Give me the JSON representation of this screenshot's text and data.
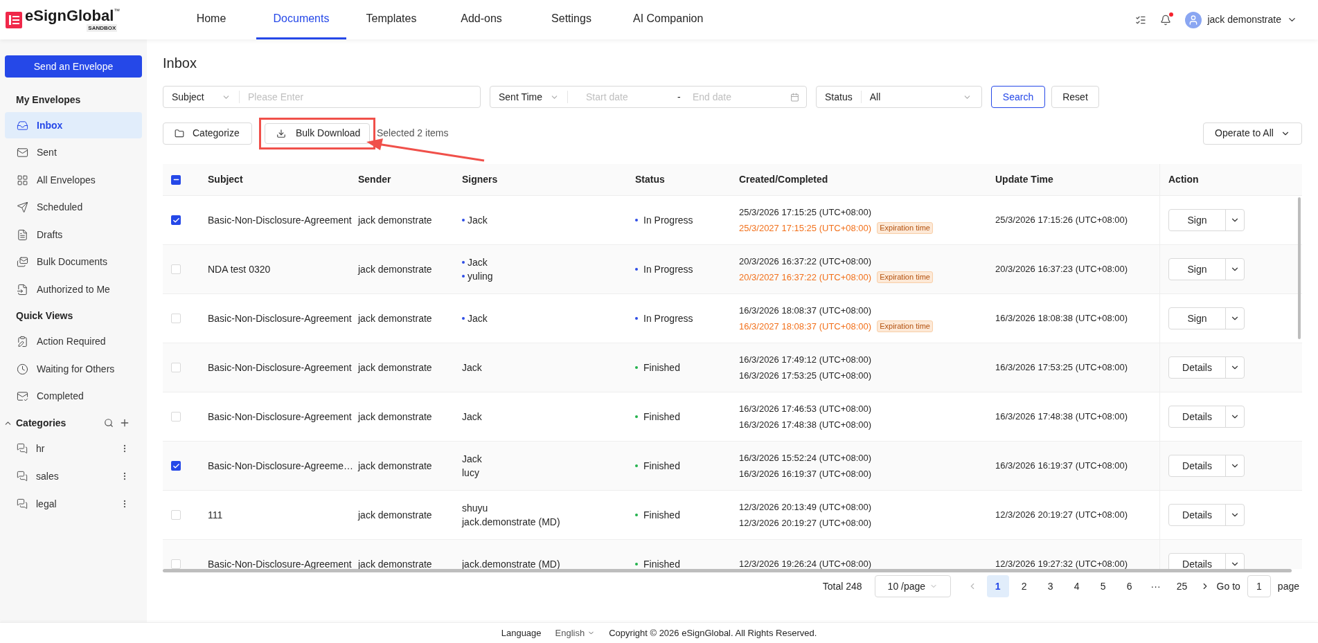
{
  "header": {
    "logo": {
      "name": "eSignGlobal",
      "tm": "™",
      "badge": "SANDBOX"
    },
    "nav": [
      {
        "label": "Home",
        "selected": false
      },
      {
        "label": "Documents",
        "selected": true
      },
      {
        "label": "Templates",
        "selected": false
      },
      {
        "label": "Add-ons",
        "selected": false
      },
      {
        "label": "Settings",
        "selected": false
      },
      {
        "label": "AI Companion",
        "selected": false
      }
    ],
    "notifications": {
      "unread": true
    },
    "user": {
      "name": "jack demonstrate"
    }
  },
  "sidebar": {
    "primary_button": "Send an Envelope",
    "sections": [
      {
        "title": "My Envelopes",
        "items": [
          {
            "label": "Inbox",
            "selected": true
          },
          {
            "label": "Sent",
            "selected": false
          },
          {
            "label": "All Envelopes",
            "selected": false
          },
          {
            "label": "Scheduled",
            "selected": false
          },
          {
            "label": "Drafts",
            "selected": false
          },
          {
            "label": "Bulk Documents",
            "selected": false
          },
          {
            "label": "Authorized to Me",
            "selected": false
          }
        ]
      },
      {
        "title": "Quick Views",
        "items": [
          {
            "label": "Action Required",
            "selected": false
          },
          {
            "label": "Waiting for Others",
            "selected": false
          },
          {
            "label": "Completed",
            "selected": false
          }
        ]
      }
    ],
    "categories": {
      "title": "Categories",
      "expanded": true,
      "items": [
        {
          "label": "hr"
        },
        {
          "label": "sales"
        },
        {
          "label": "legal"
        }
      ]
    }
  },
  "page": {
    "title": "Inbox"
  },
  "filters": {
    "subject": {
      "field": "Subject",
      "placeholder": "Please Enter"
    },
    "time": {
      "field": "Sent Time",
      "start_placeholder": "Start date",
      "separator": "-",
      "end_placeholder": "End date"
    },
    "status": {
      "field": "Status",
      "value": "All"
    },
    "search_button": "Search",
    "reset_button": "Reset"
  },
  "toolbar": {
    "categorize": "Categorize",
    "bulk_download": "Bulk Download",
    "selection": "Selected 2 items",
    "operate_all": "Operate to All",
    "highlighted": true
  },
  "table": {
    "select_all": {
      "indeterminate": true
    },
    "columns": [
      "Subject",
      "Sender",
      "Signers",
      "Status",
      "Created/Completed",
      "Update Time",
      "Action"
    ],
    "rows": [
      {
        "checked": true,
        "subject": "Basic-Non-Disclosure-Agreement",
        "sender": "jack demonstrate",
        "signers": [
          {
            "name": "Jack",
            "dot": true
          }
        ],
        "status": {
          "label": "In Progress",
          "color": "#2f4de6"
        },
        "created": "25/3/2026 17:15:25 (UTC+08:00)",
        "second": {
          "kind": "expiration",
          "date": "25/3/2027 17:15:25 (UTC+08:00)",
          "badge": "Expiration time"
        },
        "updated": "25/3/2026 17:15:26 (UTC+08:00)",
        "action": "Sign"
      },
      {
        "checked": false,
        "subject": "NDA test 0320",
        "sender": "jack demonstrate",
        "signers": [
          {
            "name": "Jack",
            "dot": true
          },
          {
            "name": "yuling",
            "dot": true
          }
        ],
        "status": {
          "label": "In Progress",
          "color": "#2f4de6"
        },
        "created": "20/3/2026 16:37:22 (UTC+08:00)",
        "second": {
          "kind": "expiration",
          "date": "20/3/2027 16:37:22 (UTC+08:00)",
          "badge": "Expiration time"
        },
        "updated": "20/3/2026 16:37:23 (UTC+08:00)",
        "action": "Sign"
      },
      {
        "checked": false,
        "subject": "Basic-Non-Disclosure-Agreement",
        "sender": "jack demonstrate",
        "signers": [
          {
            "name": "Jack",
            "dot": true
          }
        ],
        "status": {
          "label": "In Progress",
          "color": "#2f4de6"
        },
        "created": "16/3/2026 18:08:37 (UTC+08:00)",
        "second": {
          "kind": "expiration",
          "date": "16/3/2027 18:08:37 (UTC+08:00)",
          "badge": "Expiration time"
        },
        "updated": "16/3/2026 18:08:38 (UTC+08:00)",
        "action": "Sign"
      },
      {
        "checked": false,
        "subject": "Basic-Non-Disclosure-Agreement",
        "sender": "jack demonstrate",
        "signers": [
          {
            "name": "Jack",
            "dot": false
          }
        ],
        "status": {
          "label": "Finished",
          "color": "#22b14c"
        },
        "created": "16/3/2026 17:49:12 (UTC+08:00)",
        "second": {
          "kind": "completed",
          "date": "16/3/2026 17:53:25 (UTC+08:00)"
        },
        "updated": "16/3/2026 17:53:25 (UTC+08:00)",
        "action": "Details"
      },
      {
        "checked": false,
        "subject": "Basic-Non-Disclosure-Agreement",
        "sender": "jack demonstrate",
        "signers": [
          {
            "name": "Jack",
            "dot": false
          }
        ],
        "status": {
          "label": "Finished",
          "color": "#22b14c"
        },
        "created": "16/3/2026 17:46:53 (UTC+08:00)",
        "second": {
          "kind": "completed",
          "date": "16/3/2026 17:48:38 (UTC+08:00)"
        },
        "updated": "16/3/2026 17:48:38 (UTC+08:00)",
        "action": "Details"
      },
      {
        "checked": true,
        "subject": "Basic-Non-Disclosure-Agreeme…",
        "sender": "jack demonstrate",
        "signers": [
          {
            "name": "Jack",
            "dot": false
          },
          {
            "name": "lucy",
            "dot": false
          }
        ],
        "status": {
          "label": "Finished",
          "color": "#22b14c"
        },
        "created": "16/3/2026 15:52:24 (UTC+08:00)",
        "second": {
          "kind": "completed",
          "date": "16/3/2026 16:19:37 (UTC+08:00)"
        },
        "updated": "16/3/2026 16:19:37 (UTC+08:00)",
        "action": "Details"
      },
      {
        "checked": false,
        "subject": "111",
        "sender": "jack demonstrate",
        "signers": [
          {
            "name": "shuyu",
            "dot": false
          },
          {
            "name": "jack.demonstrate (MD)",
            "dot": false
          }
        ],
        "status": {
          "label": "Finished",
          "color": "#22b14c"
        },
        "created": "12/3/2026 20:13:49 (UTC+08:00)",
        "second": {
          "kind": "completed",
          "date": "12/3/2026 20:19:27 (UTC+08:00)"
        },
        "updated": "12/3/2026 20:19:27 (UTC+08:00)",
        "action": "Details"
      },
      {
        "checked": false,
        "subject": "Basic-Non-Disclosure-Agreement",
        "sender": "jack demonstrate",
        "signers": [
          {
            "name": "jack.demonstrate (MD)",
            "dot": false
          }
        ],
        "status": {
          "label": "Finished",
          "color": "#22b14c"
        },
        "created": "12/3/2026 19:26:24 (UTC+08:00)",
        "updated": "12/3/2026 19:27:32 (UTC+08:00)",
        "action": "Details"
      }
    ]
  },
  "pagination": {
    "total": "Total 248",
    "page_size": "10 /page",
    "pages": [
      {
        "label": "1",
        "selected": true
      },
      {
        "label": "2",
        "selected": false
      },
      {
        "label": "3",
        "selected": false
      },
      {
        "label": "4",
        "selected": false
      },
      {
        "label": "5",
        "selected": false
      },
      {
        "label": "6",
        "selected": false
      },
      {
        "label": "···",
        "selected": false
      },
      {
        "label": "25",
        "selected": false
      }
    ],
    "goto_label": "Go to",
    "goto_value": "1",
    "page_label": "page"
  },
  "footer": {
    "language_label": "Language",
    "language": "English",
    "copyright": "Copyright © 2026 eSignGlobal. All Rights Reserved."
  }
}
